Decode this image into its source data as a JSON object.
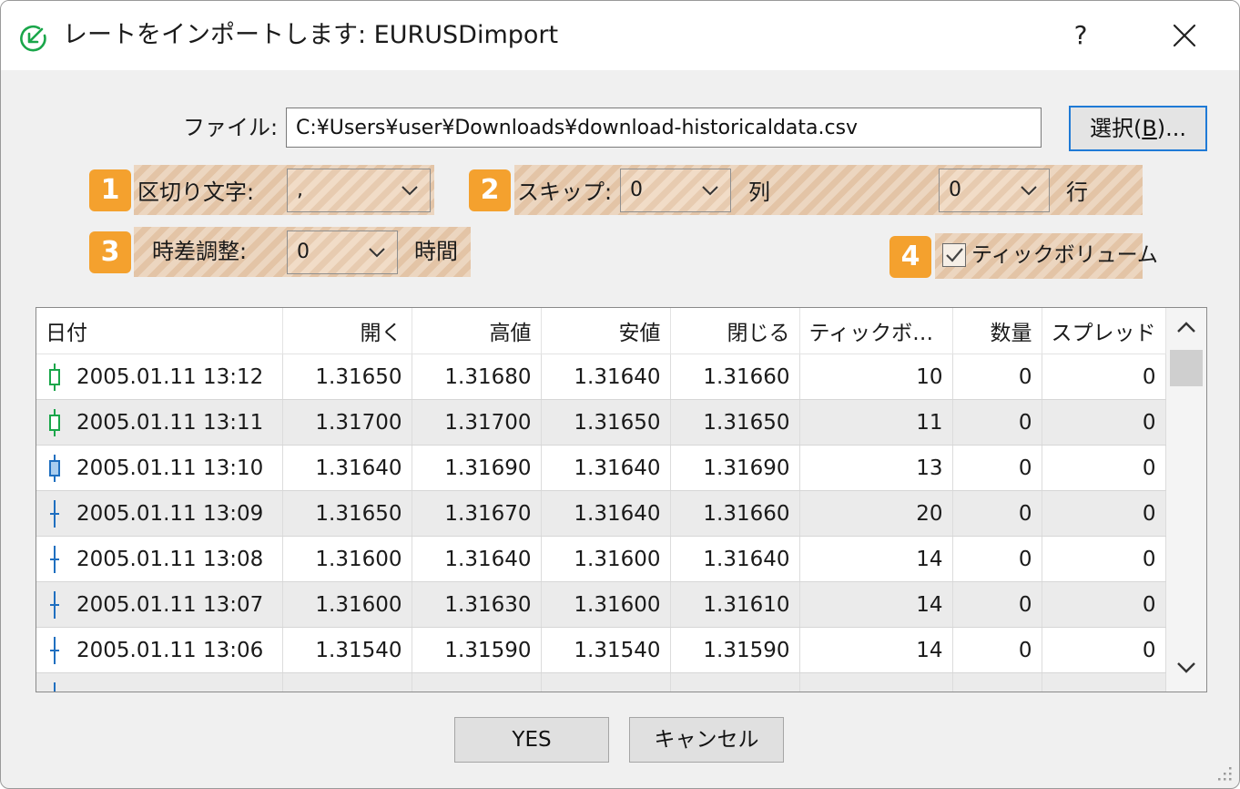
{
  "window": {
    "title": "レートをインポートします: EURUSDimport",
    "help_label": "?",
    "icon": "import-arrow-icon",
    "accent_color": "#1aa64a"
  },
  "file": {
    "label": "ファイル:",
    "path": "C:¥Users¥user¥Downloads¥download-historicaldata.csv",
    "browse_label": "選択(",
    "browse_accel": "B",
    "browse_suffix": ")..."
  },
  "options": {
    "delimiter": {
      "badge": "1",
      "label": "区切り文字:",
      "value": ","
    },
    "skip": {
      "badge": "2",
      "label": "スキップ:",
      "columns_value": "0",
      "columns_unit": "列",
      "rows_value": "0",
      "rows_unit": "行"
    },
    "time_offset": {
      "badge": "3",
      "label": "時差調整:",
      "value": "0",
      "unit": "時間"
    },
    "tick_volume": {
      "badge": "4",
      "label": "ティックボリューム",
      "checked": true
    }
  },
  "highlight_color": "#f4a12e",
  "table": {
    "columns": [
      "日付",
      "開く",
      "高値",
      "安値",
      "閉じる",
      "ティックボリ…",
      "数量",
      "スプレッド"
    ],
    "rows": [
      {
        "candle": "green-candle-icon",
        "date": "2005.01.11 13:12",
        "open": "1.31650",
        "high": "1.31680",
        "low": "1.31640",
        "close": "1.31660",
        "tick_volume": "10",
        "volume": "0",
        "spread": "0"
      },
      {
        "candle": "green-candle-icon",
        "date": "2005.01.11 13:11",
        "open": "1.31700",
        "high": "1.31700",
        "low": "1.31650",
        "close": "1.31650",
        "tick_volume": "11",
        "volume": "0",
        "spread": "0"
      },
      {
        "candle": "blue-candle-icon",
        "date": "2005.01.11 13:10",
        "open": "1.31640",
        "high": "1.31690",
        "low": "1.31640",
        "close": "1.31690",
        "tick_volume": "13",
        "volume": "0",
        "spread": "0"
      },
      {
        "candle": "doji-icon",
        "date": "2005.01.11 13:09",
        "open": "1.31650",
        "high": "1.31670",
        "low": "1.31640",
        "close": "1.31660",
        "tick_volume": "20",
        "volume": "0",
        "spread": "0"
      },
      {
        "candle": "doji-icon",
        "date": "2005.01.11 13:08",
        "open": "1.31600",
        "high": "1.31640",
        "low": "1.31600",
        "close": "1.31640",
        "tick_volume": "14",
        "volume": "0",
        "spread": "0"
      },
      {
        "candle": "doji-icon",
        "date": "2005.01.11 13:07",
        "open": "1.31600",
        "high": "1.31630",
        "low": "1.31600",
        "close": "1.31610",
        "tick_volume": "14",
        "volume": "0",
        "spread": "0"
      },
      {
        "candle": "doji-icon",
        "date": "2005.01.11 13:06",
        "open": "1.31540",
        "high": "1.31590",
        "low": "1.31540",
        "close": "1.31590",
        "tick_volume": "14",
        "volume": "0",
        "spread": "0"
      }
    ]
  },
  "buttons": {
    "ok": "YES",
    "cancel": "キャンセル"
  }
}
